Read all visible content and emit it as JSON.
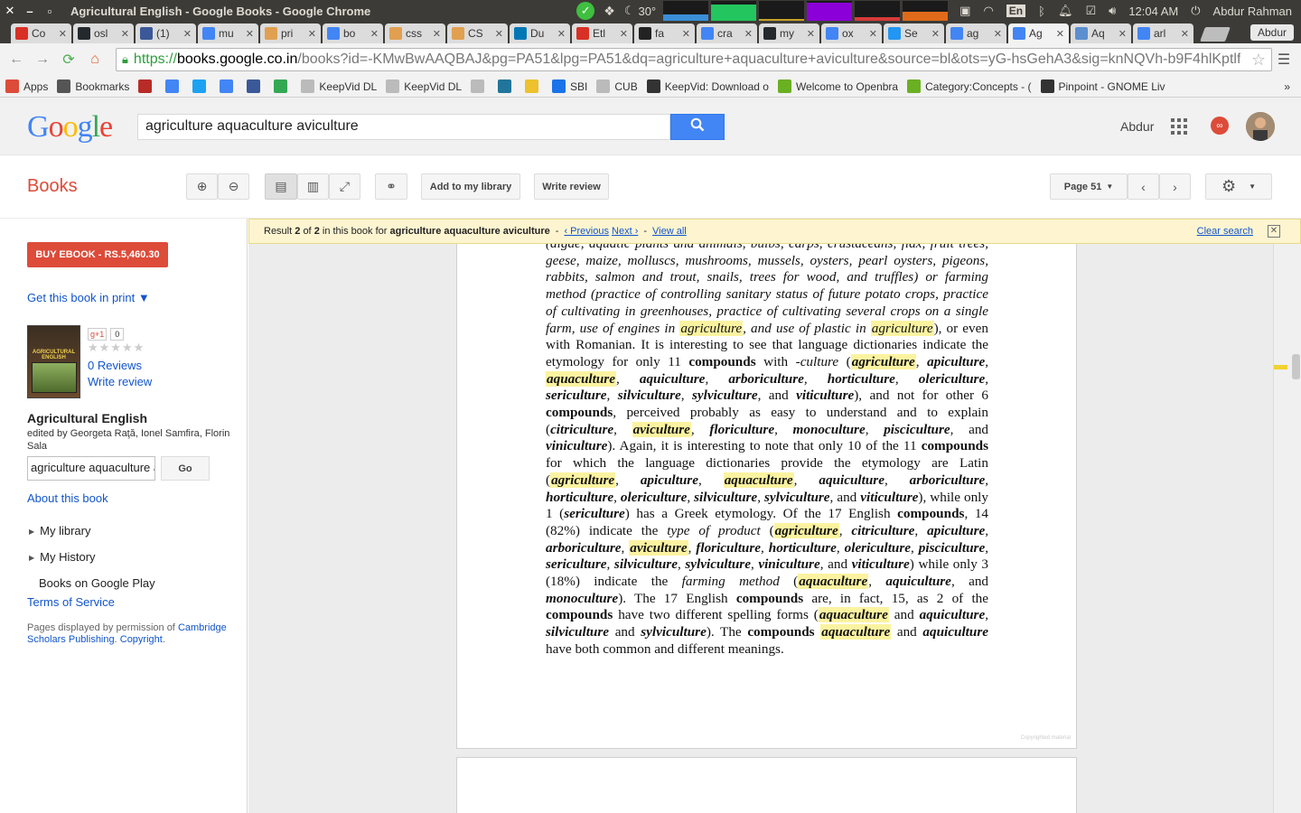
{
  "system": {
    "window_title": "Agricultural English - Google Books - Google Chrome",
    "temperature": "30°",
    "keyboard": "En",
    "time": "12:04 AM",
    "user": "Abdur Rahman"
  },
  "tabs": [
    {
      "label": "Co",
      "color": "#d93025"
    },
    {
      "label": "osl",
      "color": "#24292e"
    },
    {
      "label": "(1)",
      "color": "#3b5998"
    },
    {
      "label": "mu",
      "color": "#4285f4"
    },
    {
      "label": "pri",
      "color": "#e0a050"
    },
    {
      "label": "bo",
      "color": "#4285f4"
    },
    {
      "label": "css",
      "color": "#e0a050"
    },
    {
      "label": "CS",
      "color": "#e0a050"
    },
    {
      "label": "Du",
      "color": "#0077b5"
    },
    {
      "label": "Etl",
      "color": "#d93025"
    },
    {
      "label": "fa",
      "color": "#222222"
    },
    {
      "label": "cra",
      "color": "#4285f4"
    },
    {
      "label": "my",
      "color": "#24292e"
    },
    {
      "label": "ox",
      "color": "#4285f4"
    },
    {
      "label": "Se",
      "color": "#2196f3"
    },
    {
      "label": "ag",
      "color": "#4285f4"
    },
    {
      "label": "Ag",
      "color": "#4285f4"
    },
    {
      "label": "Aq",
      "color": "#5b8fd0"
    },
    {
      "label": "arl",
      "color": "#4285f4"
    }
  ],
  "active_tab_index": 16,
  "profile_name": "Abdur",
  "address": {
    "https": "https://",
    "host": "books.google.co.in",
    "path": "/books?id=-KMwBwAAQBAJ&pg=PA51&lpg=PA51&dq=agriculture+aquaculture+aviculture&source=bl&ots=yG-hsGehA3&sig=knNQVh-b9F4hlKptlf"
  },
  "bookmarks": [
    {
      "label": "Apps",
      "icon": "apps-icon",
      "color": "#dd4b39"
    },
    {
      "label": "Bookmarks",
      "icon": "star-icon",
      "color": "#555555"
    },
    {
      "label": "",
      "icon": "quora-icon",
      "color": "#b92b27"
    },
    {
      "label": "",
      "icon": "google-icon",
      "color": "#4285f4"
    },
    {
      "label": "",
      "icon": "twitter-icon",
      "color": "#1da1f2"
    },
    {
      "label": "",
      "icon": "google-icon",
      "color": "#4285f4"
    },
    {
      "label": "",
      "icon": "facebook-icon",
      "color": "#3b5998"
    },
    {
      "label": "",
      "icon": "drive-icon",
      "color": "#34a853"
    },
    {
      "label": "KeepVid DL",
      "icon": "page-icon",
      "color": "#bbbbbb"
    },
    {
      "label": "KeepVid DL",
      "icon": "page-icon",
      "color": "#bbbbbb"
    },
    {
      "label": "",
      "icon": "page-icon",
      "color": "#bbbbbb"
    },
    {
      "label": "",
      "icon": "wordpress-icon",
      "color": "#21759b"
    },
    {
      "label": "",
      "icon": "2048-icon",
      "color": "#edc22e"
    },
    {
      "label": "SBI",
      "icon": "sbi-icon",
      "color": "#1a73e8"
    },
    {
      "label": "CUB",
      "icon": "page-icon",
      "color": "#bbbbbb"
    },
    {
      "label": "KeepVid: Download o",
      "icon": "keepvid-icon",
      "color": "#333333"
    },
    {
      "label": "Welcome to Openbra",
      "icon": "openbravo-icon",
      "color": "#6ab023"
    },
    {
      "label": "Category:Concepts - (",
      "icon": "openbravo-icon",
      "color": "#6ab023"
    },
    {
      "label": "Pinpoint - GNOME Liv",
      "icon": "gnome-icon",
      "color": "#333333"
    }
  ],
  "google": {
    "logo": "Google",
    "query": "agriculture aquaculture aviculture",
    "user": "Abdur"
  },
  "books_toolbar": {
    "title": "Books",
    "add_library": "Add to my library",
    "write_review": "Write review",
    "page_select": "Page 51"
  },
  "result": {
    "prefix": "Result",
    "current": "2",
    "of": "of",
    "total": "2",
    "in_text": "in this book for",
    "query": "agriculture aquaculture aviculture",
    "previous": "‹ Previous",
    "next": "Next ›",
    "view_all": "View all",
    "clear": "Clear search"
  },
  "sidebar": {
    "buy": "BUY EBOOK - RS.5,460.30",
    "get_book": "Get this book in print ▼",
    "plusone": "g+1",
    "plusone_count": "0",
    "reviews": "0 Reviews",
    "write_review": "Write review",
    "book_title": "Agricultural English",
    "authors": "edited by Georgeta Raţă, Ionel Samfira, Florin Sala",
    "search_value": "agriculture aquaculture aviculture",
    "go": "Go",
    "about": "About this book",
    "my_library": "My library",
    "my_history": "My History",
    "play": "Books on Google Play",
    "tos": "Terms of Service",
    "perm_text": "Pages displayed by permission of",
    "perm_publisher": "Cambridge Scholars Publishing",
    "perm_copyright": "Copyright",
    "cover_title": "AGRICULTURAL ENGLISH"
  },
  "page_segments": [
    {
      "t": "(algae, aquatic plants and animals, bulbs, carps, crustaceans, flax, fruit trees, geese, maize, molluscs, mushrooms, mussels, oysters, pearl oysters, pigeons, rabbits, salmon and trout, snails, trees for wood, and truffles) or farming method (practice of controlling sanitary status of future potato crops, practice of cultivating in greenhouses, practice of cultivating several crops on a single farm, use of engines in ",
      "s": "i"
    },
    {
      "t": "agriculture",
      "s": "ih"
    },
    {
      "t": ", and use of plastic in ",
      "s": "i"
    },
    {
      "t": "agriculture",
      "s": "ih"
    },
    {
      "t": "), or even with Romanian. It is interesting to see that language dictionaries indicate the etymology for only 11 ",
      "s": ""
    },
    {
      "t": "compounds",
      "s": "b"
    },
    {
      "t": " with -",
      "s": ""
    },
    {
      "t": "culture",
      "s": "i"
    },
    {
      "t": " (",
      "s": ""
    },
    {
      "t": "agriculture",
      "s": "bih"
    },
    {
      "t": ", ",
      "s": ""
    },
    {
      "t": "apiculture",
      "s": "bi"
    },
    {
      "t": ", ",
      "s": ""
    },
    {
      "t": "aquaculture",
      "s": "bih"
    },
    {
      "t": ", ",
      "s": ""
    },
    {
      "t": "aquiculture",
      "s": "bi"
    },
    {
      "t": ", ",
      "s": ""
    },
    {
      "t": "arboriculture",
      "s": "bi"
    },
    {
      "t": ", ",
      "s": ""
    },
    {
      "t": "horticulture",
      "s": "bi"
    },
    {
      "t": ", ",
      "s": ""
    },
    {
      "t": "olericulture",
      "s": "bi"
    },
    {
      "t": ", ",
      "s": ""
    },
    {
      "t": "sericulture",
      "s": "bi"
    },
    {
      "t": ", ",
      "s": ""
    },
    {
      "t": "silviculture",
      "s": "bi"
    },
    {
      "t": ", ",
      "s": ""
    },
    {
      "t": "sylviculture",
      "s": "bi"
    },
    {
      "t": ", and ",
      "s": ""
    },
    {
      "t": "viticulture",
      "s": "bi"
    },
    {
      "t": "), and not for other 6 ",
      "s": ""
    },
    {
      "t": "compounds",
      "s": "b"
    },
    {
      "t": ", perceived probably as easy to understand and to explain (",
      "s": ""
    },
    {
      "t": "citriculture",
      "s": "bi"
    },
    {
      "t": ", ",
      "s": ""
    },
    {
      "t": "aviculture",
      "s": "bih"
    },
    {
      "t": ", ",
      "s": ""
    },
    {
      "t": "floriculture",
      "s": "bi"
    },
    {
      "t": ", ",
      "s": ""
    },
    {
      "t": "monoculture",
      "s": "bi"
    },
    {
      "t": ", ",
      "s": ""
    },
    {
      "t": "pisciculture",
      "s": "bi"
    },
    {
      "t": ", and ",
      "s": ""
    },
    {
      "t": "viniculture",
      "s": "bi"
    },
    {
      "t": "). Again, it is interesting to note that only 10 of the 11 ",
      "s": ""
    },
    {
      "t": "compounds",
      "s": "b"
    },
    {
      "t": " for which the language dictionaries provide the etymology are Latin (",
      "s": ""
    },
    {
      "t": "agriculture",
      "s": "bih"
    },
    {
      "t": ", ",
      "s": ""
    },
    {
      "t": "apiculture",
      "s": "bi"
    },
    {
      "t": ", ",
      "s": ""
    },
    {
      "t": "aquaculture",
      "s": "bih"
    },
    {
      "t": ", ",
      "s": ""
    },
    {
      "t": "aquiculture",
      "s": "bi"
    },
    {
      "t": ", ",
      "s": ""
    },
    {
      "t": "arboriculture",
      "s": "bi"
    },
    {
      "t": ", ",
      "s": ""
    },
    {
      "t": "horticulture",
      "s": "bi"
    },
    {
      "t": ", ",
      "s": ""
    },
    {
      "t": "olericulture",
      "s": "bi"
    },
    {
      "t": ", ",
      "s": ""
    },
    {
      "t": "silviculture",
      "s": "bi"
    },
    {
      "t": ", ",
      "s": ""
    },
    {
      "t": "sylviculture",
      "s": "bi"
    },
    {
      "t": ", and ",
      "s": ""
    },
    {
      "t": "viticulture",
      "s": "bi"
    },
    {
      "t": "), while only 1 (",
      "s": ""
    },
    {
      "t": "sericulture",
      "s": "bi"
    },
    {
      "t": ") has a Greek etymology. Of the 17 English ",
      "s": ""
    },
    {
      "t": "compounds",
      "s": "b"
    },
    {
      "t": ", 14 (82%) indicate the ",
      "s": ""
    },
    {
      "t": "type of product",
      "s": "i"
    },
    {
      "t": " (",
      "s": ""
    },
    {
      "t": "agriculture",
      "s": "bih"
    },
    {
      "t": ", ",
      "s": ""
    },
    {
      "t": "citriculture",
      "s": "bi"
    },
    {
      "t": ", ",
      "s": ""
    },
    {
      "t": "apiculture",
      "s": "bi"
    },
    {
      "t": ", ",
      "s": ""
    },
    {
      "t": "arboriculture",
      "s": "bi"
    },
    {
      "t": ", ",
      "s": ""
    },
    {
      "t": "aviculture",
      "s": "bih"
    },
    {
      "t": ", ",
      "s": ""
    },
    {
      "t": "floriculture",
      "s": "bi"
    },
    {
      "t": ", ",
      "s": ""
    },
    {
      "t": "horticulture",
      "s": "bi"
    },
    {
      "t": ", ",
      "s": ""
    },
    {
      "t": "olericulture",
      "s": "bi"
    },
    {
      "t": ", ",
      "s": ""
    },
    {
      "t": "pisciculture",
      "s": "bi"
    },
    {
      "t": ", ",
      "s": ""
    },
    {
      "t": "sericulture",
      "s": "bi"
    },
    {
      "t": ", ",
      "s": ""
    },
    {
      "t": "silviculture",
      "s": "bi"
    },
    {
      "t": ", ",
      "s": ""
    },
    {
      "t": "sylviculture",
      "s": "bi"
    },
    {
      "t": ", ",
      "s": ""
    },
    {
      "t": "viniculture",
      "s": "bi"
    },
    {
      "t": ", and ",
      "s": ""
    },
    {
      "t": "viticulture",
      "s": "bi"
    },
    {
      "t": ") while only 3 (18%) indicate the ",
      "s": ""
    },
    {
      "t": "farming method",
      "s": "i"
    },
    {
      "t": " (",
      "s": ""
    },
    {
      "t": "aquaculture",
      "s": "bih"
    },
    {
      "t": ", ",
      "s": ""
    },
    {
      "t": "aquiculture",
      "s": "bi"
    },
    {
      "t": ", and ",
      "s": ""
    },
    {
      "t": "monoculture",
      "s": "bi"
    },
    {
      "t": "). The 17 English ",
      "s": ""
    },
    {
      "t": "compounds",
      "s": "b"
    },
    {
      "t": " are, in fact, 15, as 2 of the ",
      "s": ""
    },
    {
      "t": "compounds",
      "s": "b"
    },
    {
      "t": " have two different spelling forms (",
      "s": ""
    },
    {
      "t": "aquaculture",
      "s": "bih"
    },
    {
      "t": " and ",
      "s": ""
    },
    {
      "t": "aquiculture",
      "s": "bi"
    },
    {
      "t": ", ",
      "s": ""
    },
    {
      "t": "silviculture",
      "s": "bi"
    },
    {
      "t": " and ",
      "s": ""
    },
    {
      "t": "sylviculture",
      "s": "bi"
    },
    {
      "t": "). The ",
      "s": ""
    },
    {
      "t": "compounds",
      "s": "b"
    },
    {
      "t": " ",
      "s": ""
    },
    {
      "t": "aquaculture",
      "s": "bih"
    },
    {
      "t": " and ",
      "s": ""
    },
    {
      "t": "aquiculture",
      "s": "bi"
    },
    {
      "t": " have both common and different meanings.",
      "s": ""
    }
  ],
  "copyright_mark": "Copyrighted material"
}
